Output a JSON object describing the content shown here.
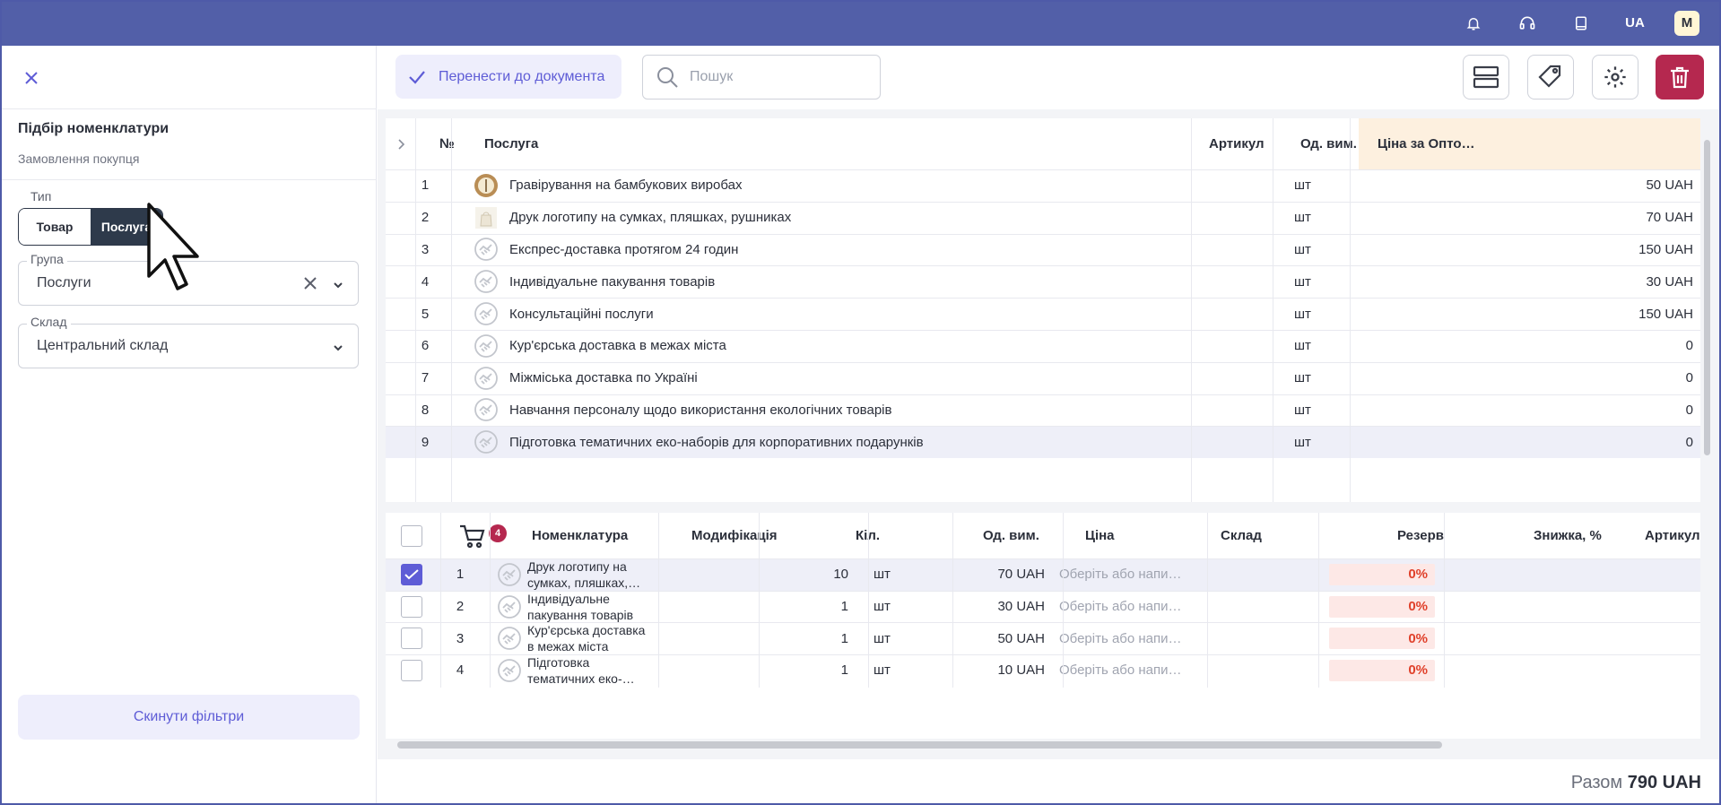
{
  "topbar": {
    "lang": "UA",
    "avatar": "M",
    "icons": [
      "bell-icon",
      "headset-icon",
      "book-icon"
    ]
  },
  "left": {
    "title": "Підбір номенклатури",
    "subtitle": "Замовлення покупця",
    "type_label": "Тип",
    "type_options": [
      "Товар",
      "Послуга"
    ],
    "type_selected": "Послуга",
    "group_label": "Група",
    "group_value": "Послуги",
    "warehouse_label": "Склад",
    "warehouse_value": "Центральний склад",
    "reset_label": "Скинути фільтри"
  },
  "toolbar": {
    "transfer_label": "Перенести до документа",
    "search_placeholder": "Пошук"
  },
  "catalog": {
    "headers": {
      "num": "№",
      "service": "Послуга",
      "sku": "Артикул",
      "unit": "Од. вим.",
      "price": "Ціна за Опто…"
    },
    "rows": [
      {
        "n": "1",
        "name": "Гравірування на бамбукових виробах",
        "unit": "шт",
        "price": "50  UAH",
        "thumb": "bamboo"
      },
      {
        "n": "2",
        "name": "Друк логотипу на сумках, пляшках, рушниках",
        "unit": "шт",
        "price": "70  UAH",
        "thumb": "bag"
      },
      {
        "n": "3",
        "name": "Експрес-доставка протягом 24 годин",
        "unit": "шт",
        "price": "150  UAH",
        "thumb": "handshake"
      },
      {
        "n": "4",
        "name": "Індивідуальне пакування товарів",
        "unit": "шт",
        "price": "30  UAH",
        "thumb": "handshake"
      },
      {
        "n": "5",
        "name": "Консультаційні послуги",
        "unit": "шт",
        "price": "150  UAH",
        "thumb": "handshake"
      },
      {
        "n": "6",
        "name": "Кур'єрська доставка в межах міста",
        "unit": "шт",
        "price": "0",
        "thumb": "handshake"
      },
      {
        "n": "7",
        "name": "Міжміська доставка по Україні",
        "unit": "шт",
        "price": "0",
        "thumb": "handshake"
      },
      {
        "n": "8",
        "name": "Навчання персоналу щодо використання екологічних товарів",
        "unit": "шт",
        "price": "0",
        "thumb": "handshake"
      },
      {
        "n": "9",
        "name": "Підготовка тематичних еко-наборів для корпоративних подарунків",
        "unit": "шт",
        "price": "0",
        "thumb": "handshake"
      }
    ]
  },
  "cart": {
    "count": "4",
    "headers": {
      "name": "Номенклатура",
      "mod": "Модифікація",
      "qty": "Кіл.",
      "unit": "Од. вим.",
      "price": "Ціна",
      "warehouse": "Склад",
      "reserve": "Резерв",
      "discount": "Знижка, %",
      "sku": "Артикул"
    },
    "warehouse_placeholder": "Оберіть або напи…",
    "rows": [
      {
        "n": "1",
        "name1": "Друк логотипу на",
        "name2": "сумках, пляшках,…",
        "qty": "10",
        "unit": "шт",
        "price": "70  UAH",
        "discount": "0%",
        "checked": true
      },
      {
        "n": "2",
        "name1": "Індивідуальне",
        "name2": "пакування товарів",
        "qty": "1",
        "unit": "шт",
        "price": "30  UAH",
        "discount": "0%",
        "checked": false
      },
      {
        "n": "3",
        "name1": "Кур'єрська доставка",
        "name2": "в межах міста",
        "qty": "1",
        "unit": "шт",
        "price": "50  UAH",
        "discount": "0%",
        "checked": false
      },
      {
        "n": "4",
        "name1": "Підготовка",
        "name2": "тематичних еко-…",
        "qty": "1",
        "unit": "шт",
        "price": "10  UAH",
        "discount": "0%",
        "checked": false
      }
    ]
  },
  "footer": {
    "total_label": "Разом",
    "total_value": "790 UAH"
  },
  "colors": {
    "topbar": "#525fa8",
    "accent": "#5e5cd6",
    "danger": "#b5284f",
    "discount": "#e0412b"
  }
}
